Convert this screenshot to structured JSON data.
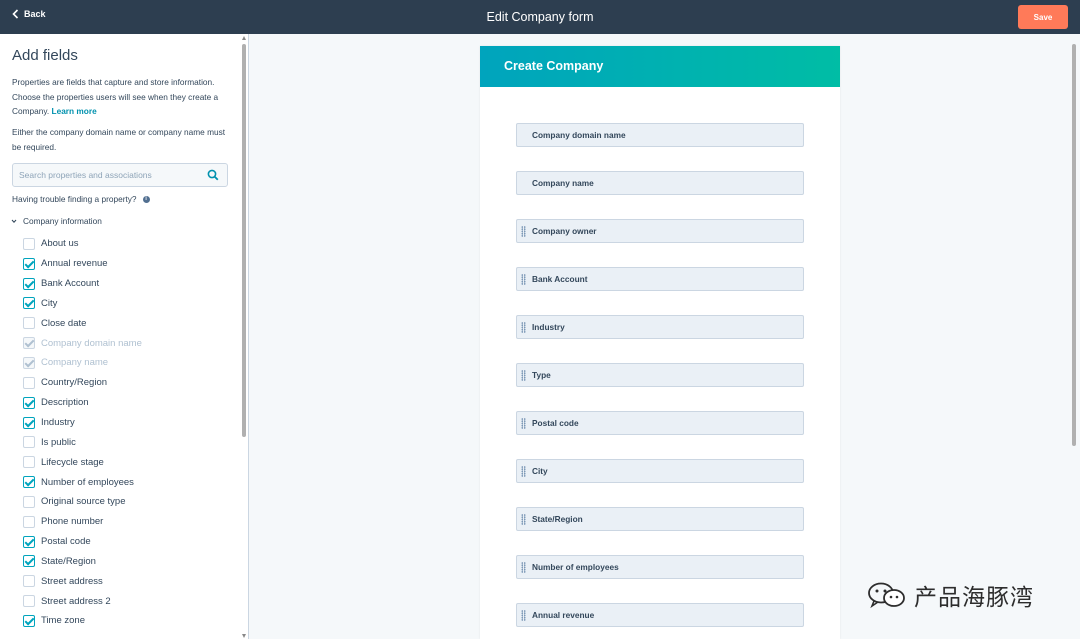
{
  "topbar": {
    "back_label": "Back",
    "title": "Edit Company form",
    "save_label": "Save"
  },
  "sidebar": {
    "title": "Add fields",
    "description": "Properties are fields that capture and store information. Choose the properties users will see when they create a Company.",
    "learn_more": "Learn more",
    "note": "Either the company domain name or company name must be required.",
    "search_placeholder": "Search properties and associations",
    "trouble": "Having trouble finding a property?",
    "group_label": "Company information",
    "properties": [
      {
        "label": "About us",
        "state": "unchecked"
      },
      {
        "label": "Annual revenue",
        "state": "checked"
      },
      {
        "label": "Bank Account",
        "state": "checked"
      },
      {
        "label": "City",
        "state": "checked"
      },
      {
        "label": "Close date",
        "state": "unchecked"
      },
      {
        "label": "Company domain name",
        "state": "disabled"
      },
      {
        "label": "Company name",
        "state": "disabled"
      },
      {
        "label": "Country/Region",
        "state": "unchecked"
      },
      {
        "label": "Description",
        "state": "checked"
      },
      {
        "label": "Industry",
        "state": "checked"
      },
      {
        "label": "Is public",
        "state": "unchecked"
      },
      {
        "label": "Lifecycle stage",
        "state": "unchecked"
      },
      {
        "label": "Number of employees",
        "state": "checked"
      },
      {
        "label": "Original source type",
        "state": "unchecked"
      },
      {
        "label": "Phone number",
        "state": "unchecked"
      },
      {
        "label": "Postal code",
        "state": "checked"
      },
      {
        "label": "State/Region",
        "state": "checked"
      },
      {
        "label": "Street address",
        "state": "unchecked"
      },
      {
        "label": "Street address 2",
        "state": "unchecked"
      },
      {
        "label": "Time zone",
        "state": "checked"
      }
    ]
  },
  "form": {
    "header": "Create Company",
    "fields": [
      {
        "label": "Company domain name",
        "draggable": false
      },
      {
        "label": "Company name",
        "draggable": false
      },
      {
        "label": "Company owner",
        "draggable": true
      },
      {
        "label": "Bank Account",
        "draggable": true
      },
      {
        "label": "Industry",
        "draggable": true
      },
      {
        "label": "Type",
        "draggable": true
      },
      {
        "label": "Postal code",
        "draggable": true
      },
      {
        "label": "City",
        "draggable": true
      },
      {
        "label": "State/Region",
        "draggable": true
      },
      {
        "label": "Number of employees",
        "draggable": true
      },
      {
        "label": "Annual revenue",
        "draggable": true
      }
    ]
  },
  "watermark": "产品海豚湾",
  "colors": {
    "topbar": "#2d3e50",
    "save": "#ff7a59",
    "accent": "#00a4bd",
    "header_gradient_end": "#00bda5"
  }
}
